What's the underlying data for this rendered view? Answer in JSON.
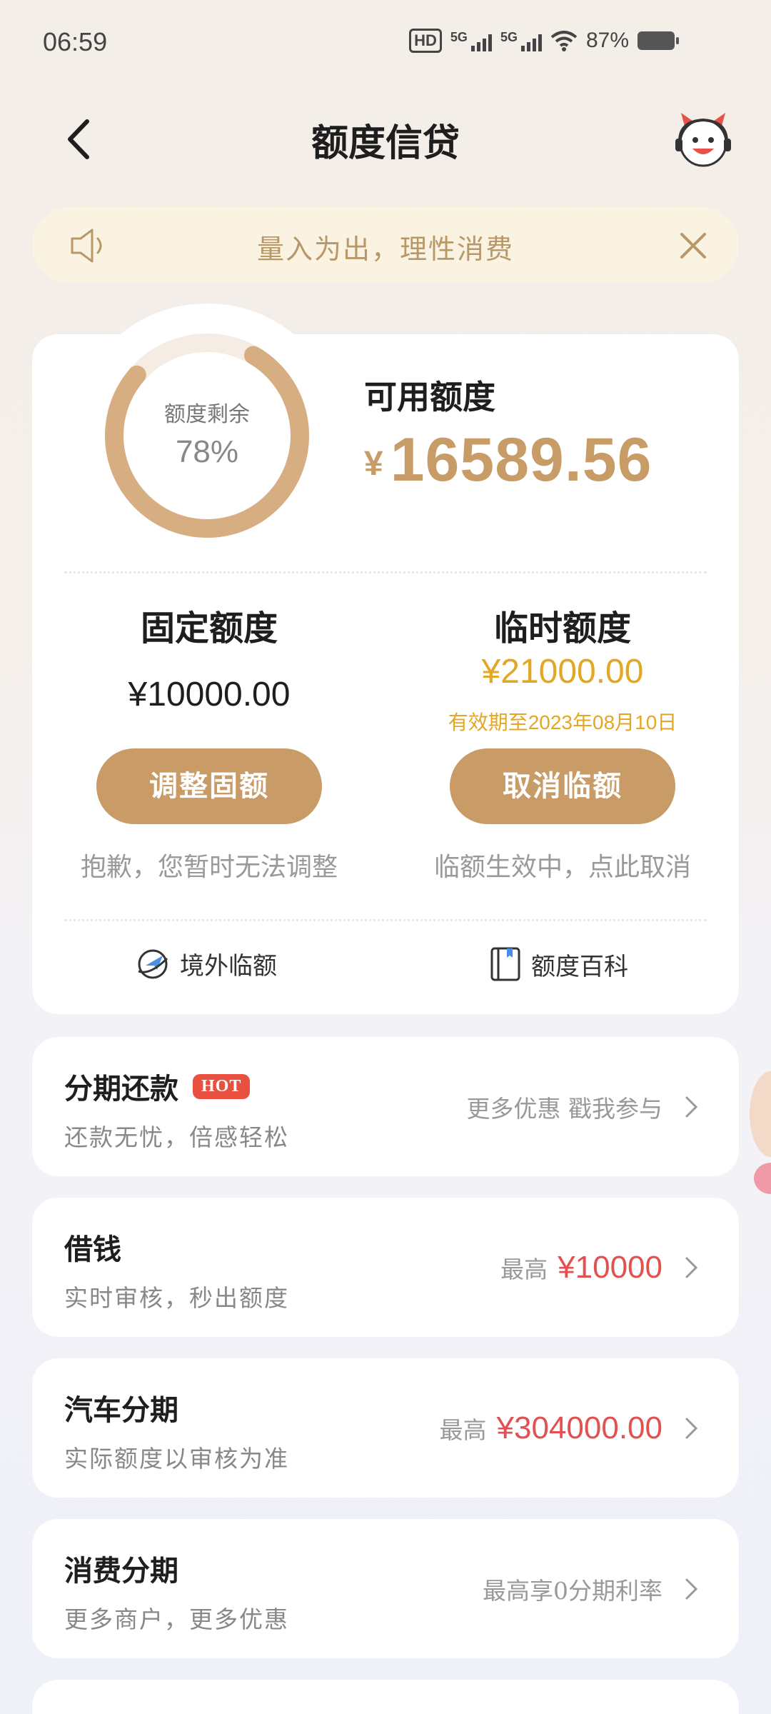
{
  "status": {
    "time": "06:59",
    "network_hd": "HD",
    "sig1": "5G",
    "sig2": "5G",
    "battery": "87%"
  },
  "header": {
    "title": "额度信贷"
  },
  "notice": {
    "text": "量入为出，理性消费"
  },
  "quota": {
    "ring_label": "额度剩余",
    "ring_value": "78%",
    "ring_fraction": 0.78,
    "available_label": "可用额度",
    "currency": "¥",
    "available_amount": "16589.56"
  },
  "fixed": {
    "title": "固定额度",
    "amount": "¥10000.00",
    "button": "调整固额",
    "note": "抱歉，您暂时无法调整"
  },
  "temp": {
    "title": "临时额度",
    "amount": "¥21000.00",
    "validity": "有效期至2023年08月10日",
    "button": "取消临额",
    "note": "临额生效中，点此取消"
  },
  "links": {
    "overseas": "境外临额",
    "wiki": "额度百科"
  },
  "items": [
    {
      "name": "分期还款",
      "badge": "HOT",
      "desc": "还款无忧，倍感轻松",
      "right_text": "更多优惠 戳我参与",
      "right_value": ""
    },
    {
      "name": "借钱",
      "desc": "实时审核，秒出额度",
      "right_text": "最高",
      "right_value": "¥10000"
    },
    {
      "name": "汽车分期",
      "desc": "实际额度以审核为准",
      "right_text": "最高",
      "right_value": "¥304000.00"
    },
    {
      "name": "消费分期",
      "desc": "更多商户，更多优惠",
      "right_text": "最高享0分期利率",
      "right_value": ""
    }
  ],
  "colors": {
    "accent": "#c99b67",
    "amount": "#c79c67",
    "red": "#e2514f",
    "gold": "#e2a825"
  }
}
